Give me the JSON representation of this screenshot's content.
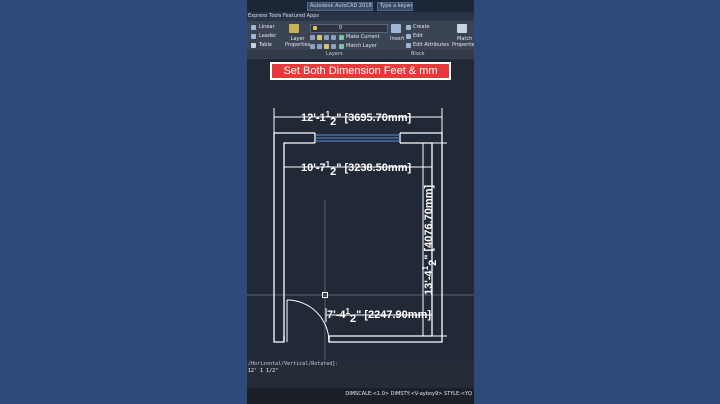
{
  "title_bar": {
    "app_title": "Autodesk AutoCAD 2018",
    "search_placeholder": "Type a keyword"
  },
  "tabs": [
    "Express Tools",
    "Featured Apps"
  ],
  "ribbon": {
    "annotation": {
      "linear": "Linear",
      "leader": "Leader",
      "table": "Table"
    },
    "layers": {
      "layer_properties": "Layer\nProperties",
      "layer_value": "0",
      "make_current": "Make Current",
      "match_layer": "Match Layer",
      "panel_label": "Layers"
    },
    "block": {
      "insert": "Insert",
      "create": "Create",
      "edit": "Edit",
      "edit_attributes": "Edit Attributes",
      "panel_label": "Block"
    },
    "properties": {
      "match_properties": "Match\nProperties"
    }
  },
  "banner": "Set Both Dimension Feet & mm",
  "dimensions": {
    "top": {
      "ft": "12'-1",
      "frac_num": "1",
      "frac_den": "2",
      "mm": "\" [3695.70mm]"
    },
    "inner": {
      "ft": "10'-7",
      "frac_num": "1",
      "frac_den": "2",
      "mm": "\" [3238.50mm]"
    },
    "vertical": {
      "ft": "13'-4",
      "frac_num": "1",
      "frac_den": "2",
      "mm": "\" [4076.70mm]"
    },
    "bottom": {
      "ft": "7'-4",
      "frac_num": "1",
      "frac_den": "2",
      "mm": "\" [2247.90mm]"
    }
  },
  "command": {
    "line1": "/Horizontal/Vertical/Rotated]:",
    "line2": "12' 1 1/2\""
  },
  "status_bar": {
    "text": "DIMSCALE:<1.0> DIMSTY:<V-ayboy9> STYLE:<YQ"
  },
  "colors": {
    "banner_red": "#e43a3a",
    "canvas": "#212836",
    "background": "#2e4a7d"
  }
}
